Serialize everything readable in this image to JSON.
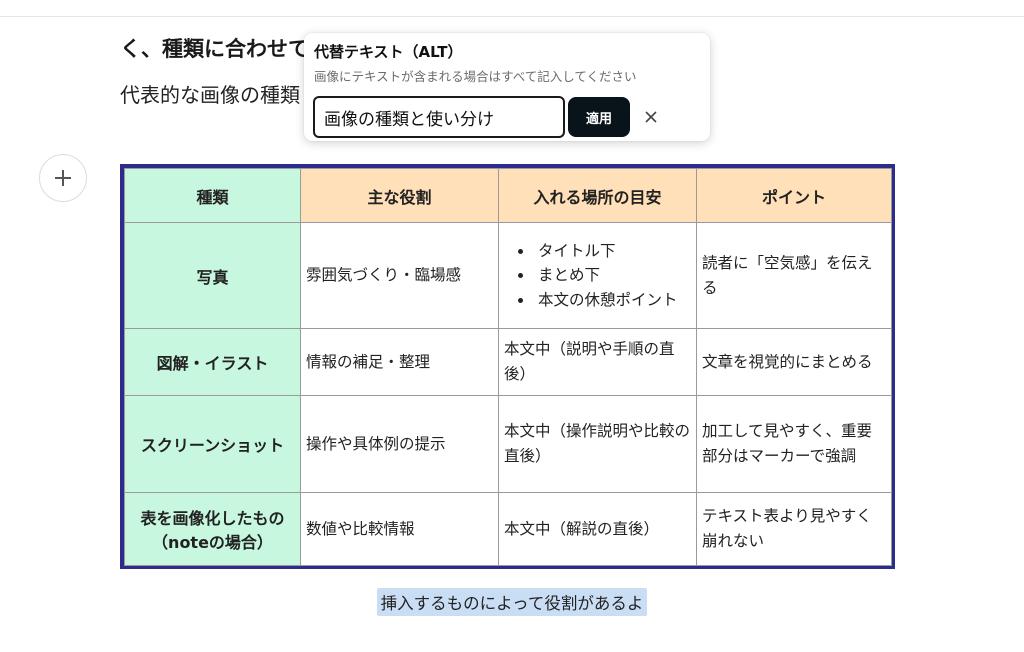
{
  "heading": "く、種類に合わせて",
  "paragraph": "代表的な画像の種類",
  "alt_popup": {
    "title": "代替テキスト（ALT）",
    "description": "画像にテキストが含まれる場合はすべて記入してください",
    "input_value": "画像の種類と使い分け",
    "apply_label": "適用",
    "close_icon": "close-icon"
  },
  "add_block_icon": "plus-icon",
  "table": {
    "headers": [
      "種類",
      "主な役割",
      "入れる場所の目安",
      "ポイント"
    ],
    "rows": [
      {
        "type": "写真",
        "role": "雰囲気づくり・臨場感",
        "place_list": [
          "タイトル下",
          "まとめ下",
          "本文の休憩ポイント"
        ],
        "point": "読者に「空気感」を伝える"
      },
      {
        "type": "図解・イラスト",
        "role": "情報の補足・整理",
        "place": "本文中（説明や手順の直後）",
        "point": "文章を視覚的にまとめる"
      },
      {
        "type": "スクリーンショット",
        "role": "操作や具体例の提示",
        "place": "本文中（操作説明や比較の直後）",
        "point": "加工して見やすく、重要部分はマーカーで強調"
      },
      {
        "type": "表を画像化したもの（noteの場合）",
        "role": "数値や比較情報",
        "place": "本文中（解説の直後）",
        "point": "テキスト表より見やすく崩れない"
      }
    ],
    "colors": {
      "border": "#2b2c8c",
      "first_col_bg": "#c8f7e0",
      "header_bg": "#ffe0b8"
    }
  },
  "caption": "挿入するものによって役割があるよ"
}
